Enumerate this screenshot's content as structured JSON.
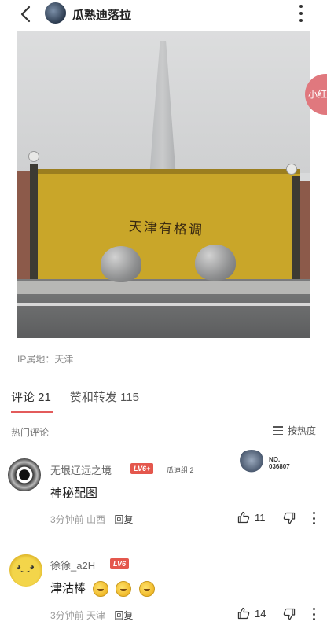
{
  "header": {
    "title": "瓜熟迪落拉",
    "back_icon": "chevron-left-icon",
    "more_icon": "more-vertical-icon"
  },
  "post": {
    "image_text": "天津有格调",
    "side_bubble": "小红",
    "ip_location": "IP属地：天津"
  },
  "tabs": [
    {
      "label": "评论 21",
      "active": true
    },
    {
      "label": "赞和转发 115",
      "active": false
    }
  ],
  "comments_header": {
    "hot_label": "热门评论",
    "sort_label": "按热度"
  },
  "comments": [
    {
      "username": "无垠辽远之境",
      "level": "LV6+",
      "fan_tag": "瓜迪组 2",
      "medal_no": "NO. 036807",
      "text": "神秘配图",
      "time": "3分钟前",
      "location": "山西",
      "reply": "回复",
      "likes": "11"
    },
    {
      "username": "徐徐_a2H",
      "level": "LV6",
      "text": "津沽棒",
      "time": "3分钟前",
      "location": "天津",
      "reply": "回复",
      "likes": "14"
    }
  ],
  "colors": {
    "accent": "#e35b5b",
    "level_badge": "#e4574d"
  }
}
